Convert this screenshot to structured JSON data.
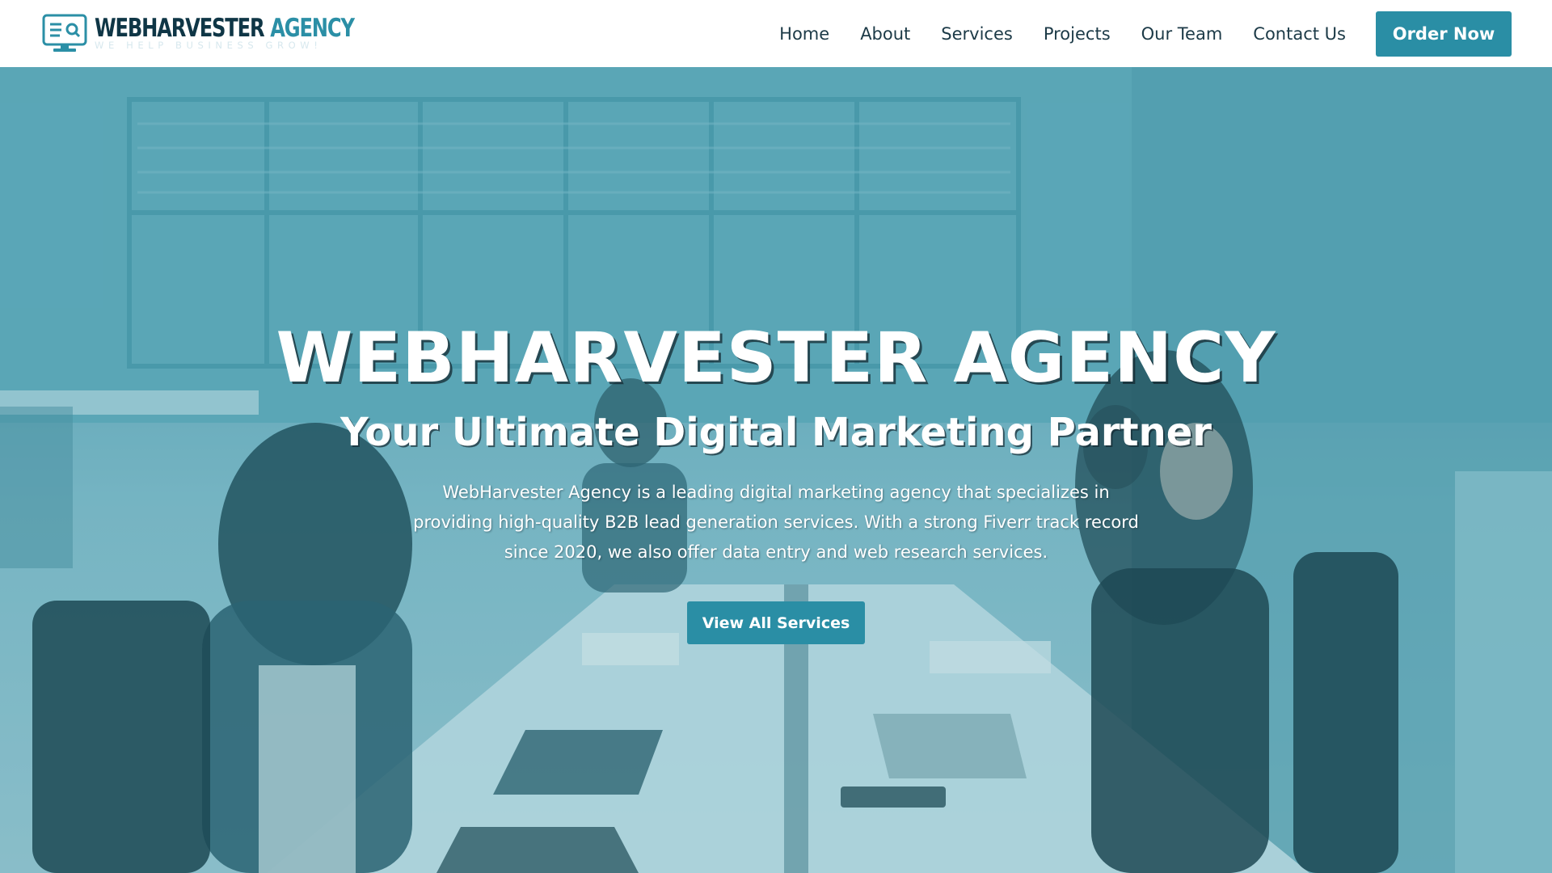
{
  "header": {
    "logo": {
      "name_dark": "WEBHARVESTER",
      "name_accent": "AGENCY",
      "tagline": "WE HELP BUSINESS GROW!",
      "icon": "monitor-search-icon"
    },
    "nav": [
      {
        "label": "Home"
      },
      {
        "label": "About"
      },
      {
        "label": "Services"
      },
      {
        "label": "Projects"
      },
      {
        "label": "Our Team"
      },
      {
        "label": "Contact Us"
      }
    ],
    "cta_label": "Order Now"
  },
  "hero": {
    "title": "WEBHARVESTER AGENCY",
    "subtitle": "Your Ultimate Digital Marketing Partner",
    "description": "WebHarvester Agency is a leading digital marketing agency that specializes in providing high-quality B2B lead generation services. With a strong Fiverr track record since 2020, we also offer data entry and web research services.",
    "button_label": "View All Services"
  },
  "colors": {
    "brand_primary": "#2a8ea5",
    "brand_dark": "#0f3646",
    "nav_text": "#1c3a47",
    "hero_tint": "#5fa6b6"
  }
}
